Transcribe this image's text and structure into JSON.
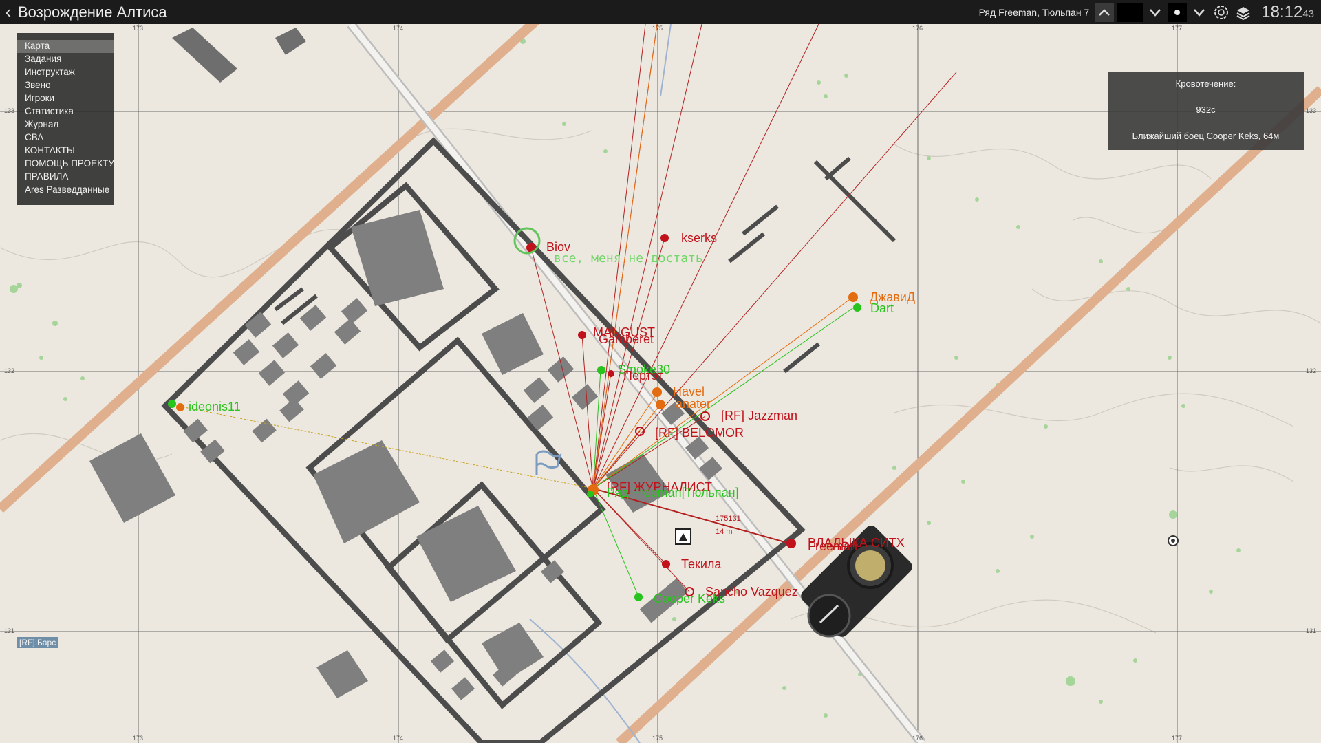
{
  "topbar": {
    "title": "Возрождение Алтиса",
    "player": "Ряд Freeman, Тюльпан 7",
    "time_main": "18:12",
    "time_sec": "43",
    "icons": [
      "chevron-up-icon",
      "color-swatch",
      "chevron-down-icon",
      "dot-icon",
      "chevron-down-icon",
      "gps-icon",
      "layers-icon"
    ]
  },
  "menu": {
    "items": [
      "Карта",
      "Задания",
      "Инструктаж",
      "Звено",
      "Игроки",
      "Статистика",
      "Журнал",
      "СВА",
      "КОНТАКТЫ",
      "ПОМОЩЬ ПРОЕКТУ",
      "ПРАВИЛА",
      "Ares Разведданные"
    ],
    "active": "Карта"
  },
  "info": {
    "line1": "Кровотечение:",
    "line2": "932с",
    "line3": "Ближайший боец Cooper  Keks, 64м"
  },
  "unit_badge": "[RF] Барс",
  "grid": {
    "x_labels": [
      "173",
      "174",
      "175",
      "176",
      "177"
    ],
    "y_labels": [
      "133",
      "132",
      "131"
    ]
  },
  "markers": {
    "biov": "Biov",
    "note": "все, меня не достать",
    "kserks": "kserks",
    "djavid": "ДжавиД",
    "dart": "Dart",
    "mangust": "MANGUST",
    "mangust2": "Gamberet",
    "smoke": "Smoke30",
    "pepter": "Пертэт",
    "havel": "Havel",
    "anater": "anater",
    "jazzman": "[RF] Jazzman",
    "belomor": "[RF] BELOMOR",
    "journalist": "[RF] ЖУРНАЛИСТ",
    "journalist2": "Ряд Freeman[Тюльпан]",
    "ideonis": "ideonis11",
    "vladyka": "ВЛАДЫКА СИТХ",
    "freeman": "Freeman",
    "tekila": "Текила",
    "sancho": "Sancho Vazquez",
    "cooper": "Cooper  Keks"
  },
  "measure": {
    "grid": "175131",
    "dist": "14 m"
  },
  "colors": {
    "map_bg": "#ece8df",
    "road": "#e2b48f",
    "building": "#7d7d7d",
    "wall": "#505050",
    "red": "#c1121b",
    "green": "#27c41d",
    "orange": "#e46c10"
  }
}
